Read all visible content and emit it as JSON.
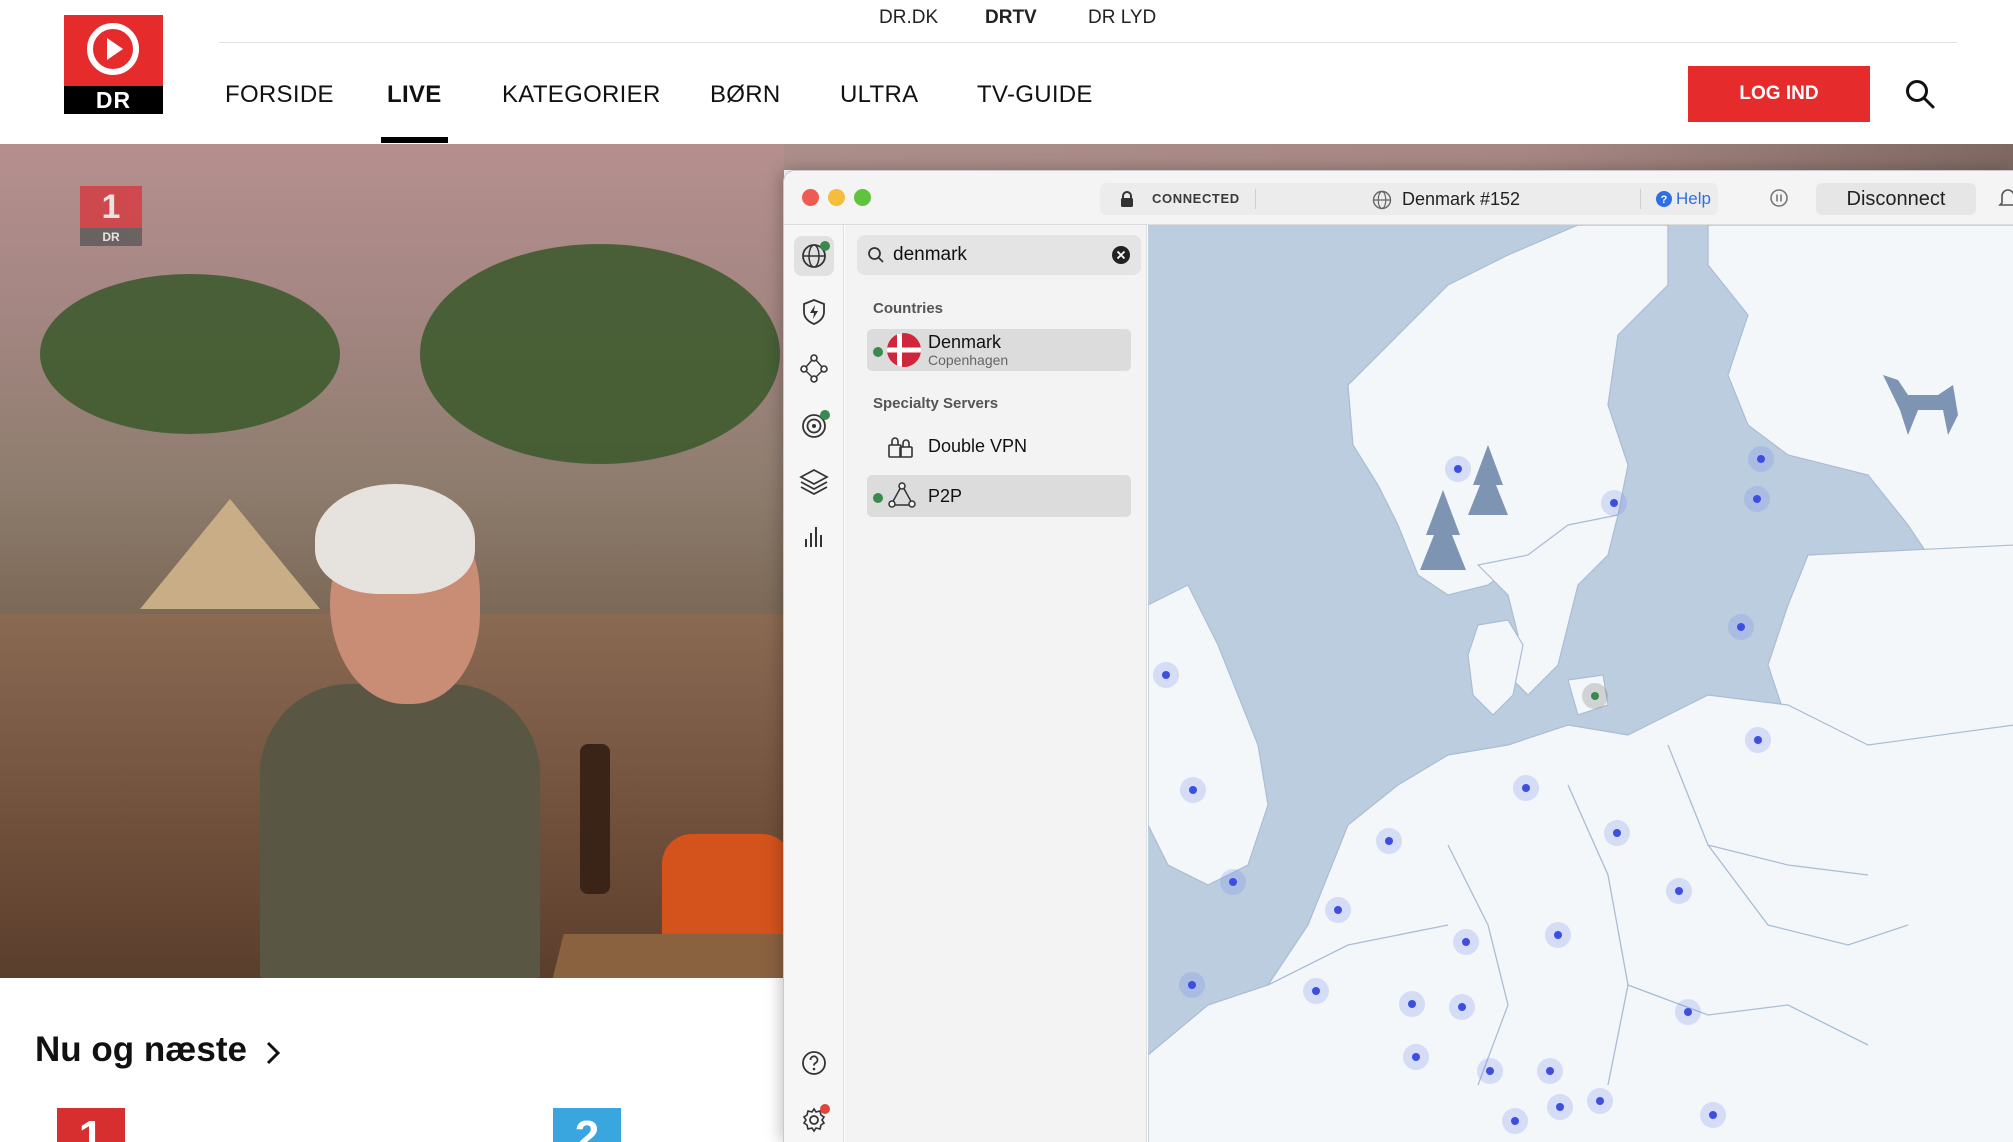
{
  "dr": {
    "logo_text": "DR",
    "top_nav": [
      {
        "label": "DR.DK",
        "active": false
      },
      {
        "label": "DRTV",
        "active": true
      },
      {
        "label": "DR LYD",
        "active": false
      }
    ],
    "main_nav": [
      {
        "label": "FORSIDE"
      },
      {
        "label": "LIVE"
      },
      {
        "label": "KATEGORIER"
      },
      {
        "label": "BØRN"
      },
      {
        "label": "ULTRA"
      },
      {
        "label": "TV-GUIDE"
      }
    ],
    "active_nav": "LIVE",
    "login_label": "LOG IND",
    "channel_badge": {
      "number": "1",
      "brand": "DR"
    },
    "section_title": "Nu og næste",
    "channel_tiles": [
      {
        "number": "1",
        "color": "#d72f2f"
      },
      {
        "number": "2",
        "color": "#3aa6e0"
      }
    ],
    "accent": "#e52b2b"
  },
  "vpn": {
    "status": "CONNECTED",
    "server": "Denmark #152",
    "help_label": "Help",
    "disconnect_label": "Disconnect",
    "search": {
      "value": "denmark"
    },
    "sections": {
      "countries_label": "Countries",
      "specialty_label": "Specialty Servers"
    },
    "countries": [
      {
        "name": "Denmark",
        "city": "Copenhagen",
        "connected": true
      }
    ],
    "specialty": [
      {
        "name": "Double VPN",
        "icon": "double-vpn-icon",
        "active": false
      },
      {
        "name": "P2P",
        "icon": "p2p-icon",
        "active": true
      }
    ],
    "sidebar_icons": [
      "globe-icon",
      "shield-bolt-icon",
      "meshnet-icon",
      "target-icon",
      "layers-icon",
      "stats-icon",
      "help-icon",
      "settings-icon"
    ],
    "colors": {
      "connected_dot": "#3a8a4e",
      "server_pin": "#3d4fe0",
      "map_water": "#bccde0",
      "map_land": "#f4f7fa",
      "help_link": "#2f6fe4"
    }
  }
}
